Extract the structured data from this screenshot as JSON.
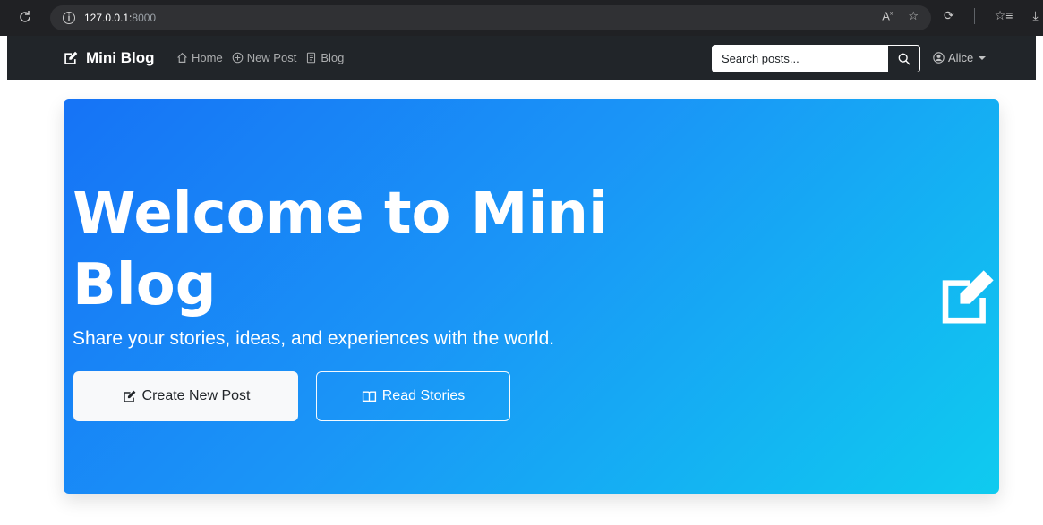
{
  "browser": {
    "url_host": "127.0.0.1:",
    "url_port": "8000"
  },
  "navbar": {
    "brand": "Mini Blog",
    "links": [
      {
        "label": "Home",
        "icon": "house-icon"
      },
      {
        "label": "New Post",
        "icon": "plus-circle-icon"
      },
      {
        "label": "Blog",
        "icon": "journal-icon"
      }
    ],
    "search_placeholder": "Search posts...",
    "user": "Alice"
  },
  "hero": {
    "title": "Welcome to Mini Blog",
    "subtitle": "Share your stories, ideas, and experiences with the world.",
    "primary_button": "Create New Post",
    "secondary_button": "Read Stories",
    "icon": "pencil-square-icon"
  },
  "colors": {
    "hero_gradient_start": "#1673f6",
    "hero_gradient_end": "#0fcbef",
    "navbar_bg": "#212529"
  }
}
